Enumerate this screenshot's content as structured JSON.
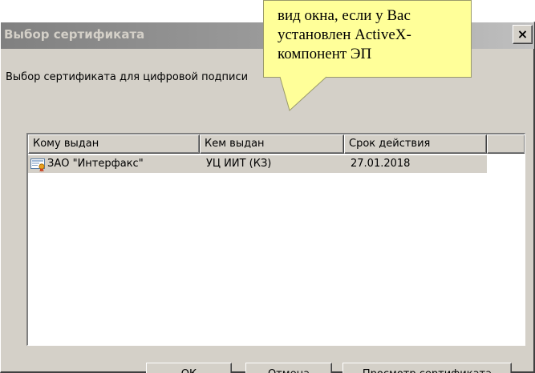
{
  "window": {
    "title": "Выбор сертификата",
    "close_label": "×",
    "prompt": "Выбор сертификата для цифровой подписи"
  },
  "list": {
    "columns": [
      "Кому выдан",
      "Кем выдан",
      "Срок действия",
      ""
    ],
    "rows": [
      {
        "issued_to": "ЗАО \"Интерфакс\"",
        "issued_by": "УЦ ИИТ (КЗ)",
        "expires": "27.01.2018",
        "icon": "certificate-icon"
      }
    ]
  },
  "buttons": {
    "ok": "ОК",
    "cancel": "Отмена",
    "view": "Просмотр сертификата"
  },
  "callout": {
    "lines": [
      "вид окна, если у Вас",
      "установлен ActiveX-",
      "компонент ЭП"
    ]
  },
  "colors": {
    "window_face": "#d4d0c8",
    "callout_fill": "#ffff99"
  }
}
